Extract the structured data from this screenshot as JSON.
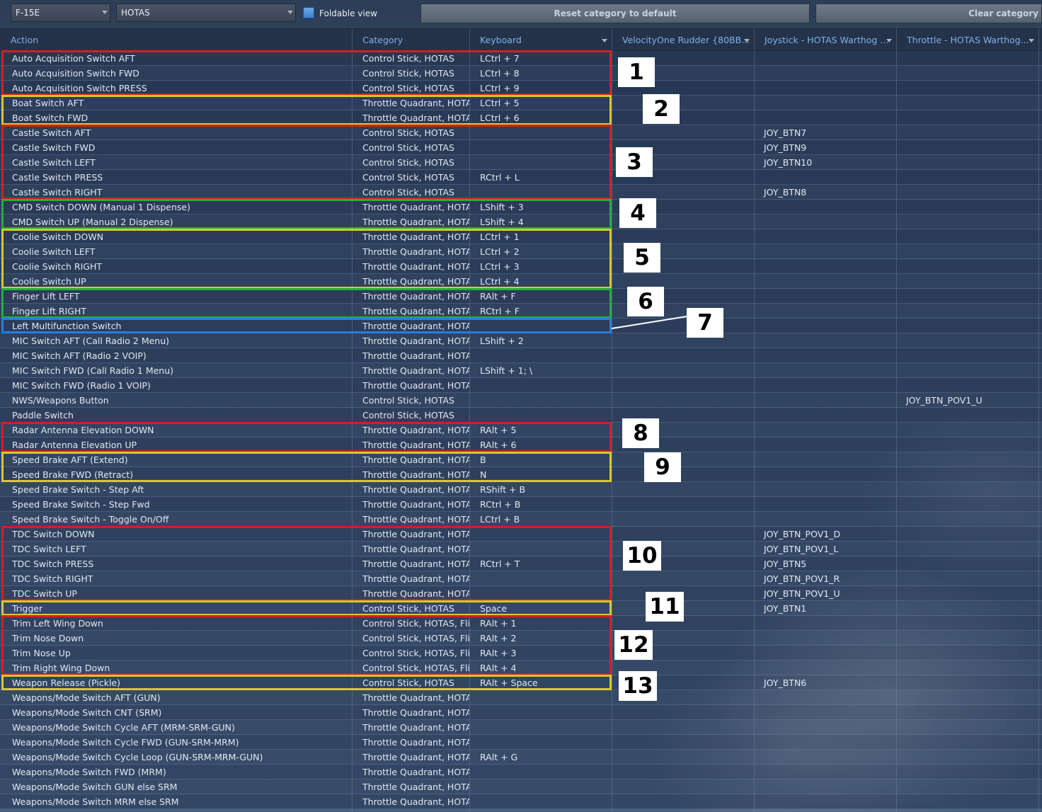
{
  "toolbar": {
    "aircraft": "F-15E",
    "category": "HOTAS",
    "foldable_label": "Foldable view",
    "reset_label": "Reset category to default",
    "clear_label": "Clear category"
  },
  "columns": {
    "action": "Action",
    "category": "Category",
    "keyboard": "Keyboard",
    "rudder": "VelocityOne Rudder {80BB...",
    "joystick": "Joystick - HOTAS Warthog ...",
    "throttle": "Throttle - HOTAS Warthog..."
  },
  "rows": [
    {
      "action": "Auto Acquisition Switch AFT",
      "category": "Control Stick, HOTAS",
      "keyboard": "LCtrl + 7",
      "rudder": "",
      "joystick": "",
      "throttle": ""
    },
    {
      "action": "Auto Acquisition Switch FWD",
      "category": "Control Stick, HOTAS",
      "keyboard": "LCtrl + 8",
      "rudder": "",
      "joystick": "",
      "throttle": ""
    },
    {
      "action": "Auto Acquisition Switch PRESS",
      "category": "Control Stick, HOTAS",
      "keyboard": "LCtrl + 9",
      "rudder": "",
      "joystick": "",
      "throttle": ""
    },
    {
      "action": "Boat Switch AFT",
      "category": "Throttle Quadrant, HOTAS",
      "keyboard": "LCtrl + 5",
      "rudder": "",
      "joystick": "",
      "throttle": ""
    },
    {
      "action": "Boat Switch FWD",
      "category": "Throttle Quadrant, HOTAS",
      "keyboard": "LCtrl + 6",
      "rudder": "",
      "joystick": "",
      "throttle": ""
    },
    {
      "action": "Castle Switch AFT",
      "category": "Control Stick, HOTAS",
      "keyboard": "",
      "rudder": "",
      "joystick": "JOY_BTN7",
      "throttle": ""
    },
    {
      "action": "Castle Switch FWD",
      "category": "Control Stick, HOTAS",
      "keyboard": "",
      "rudder": "",
      "joystick": "JOY_BTN9",
      "throttle": ""
    },
    {
      "action": "Castle Switch LEFT",
      "category": "Control Stick, HOTAS",
      "keyboard": "",
      "rudder": "",
      "joystick": "JOY_BTN10",
      "throttle": ""
    },
    {
      "action": "Castle Switch PRESS",
      "category": "Control Stick, HOTAS",
      "keyboard": "RCtrl + L",
      "rudder": "",
      "joystick": "",
      "throttle": ""
    },
    {
      "action": "Castle Switch RIGHT",
      "category": "Control Stick, HOTAS",
      "keyboard": "",
      "rudder": "",
      "joystick": "JOY_BTN8",
      "throttle": ""
    },
    {
      "action": "CMD Switch DOWN (Manual 1 Dispense)",
      "category": "Throttle Quadrant, HOTAS",
      "keyboard": "LShift + 3",
      "rudder": "",
      "joystick": "",
      "throttle": ""
    },
    {
      "action": "CMD Switch UP (Manual 2 Dispense)",
      "category": "Throttle Quadrant, HOTAS",
      "keyboard": "LShift + 4",
      "rudder": "",
      "joystick": "",
      "throttle": ""
    },
    {
      "action": "Coolie Switch DOWN",
      "category": "Throttle Quadrant, HOTAS",
      "keyboard": "LCtrl + 1",
      "rudder": "",
      "joystick": "",
      "throttle": ""
    },
    {
      "action": "Coolie Switch LEFT",
      "category": "Throttle Quadrant, HOTAS",
      "keyboard": "LCtrl + 2",
      "rudder": "",
      "joystick": "",
      "throttle": ""
    },
    {
      "action": "Coolie Switch RIGHT",
      "category": "Throttle Quadrant, HOTAS",
      "keyboard": "LCtrl + 3",
      "rudder": "",
      "joystick": "",
      "throttle": ""
    },
    {
      "action": "Coolie Switch UP",
      "category": "Throttle Quadrant, HOTAS",
      "keyboard": "LCtrl + 4",
      "rudder": "",
      "joystick": "",
      "throttle": ""
    },
    {
      "action": "Finger Lift LEFT",
      "category": "Throttle Quadrant, HOTAS",
      "keyboard": "RAlt + F",
      "rudder": "",
      "joystick": "",
      "throttle": ""
    },
    {
      "action": "Finger Lift RIGHT",
      "category": "Throttle Quadrant, HOTAS",
      "keyboard": "RCtrl + F",
      "rudder": "",
      "joystick": "",
      "throttle": ""
    },
    {
      "action": "Left Multifunction Switch",
      "category": "Throttle Quadrant, HOTAS",
      "keyboard": "",
      "rudder": "",
      "joystick": "",
      "throttle": ""
    },
    {
      "action": "MIC Switch AFT (Call Radio 2 Menu)",
      "category": "Throttle Quadrant, HOTAS",
      "keyboard": "LShift + 2",
      "rudder": "",
      "joystick": "",
      "throttle": ""
    },
    {
      "action": "MIC Switch AFT (Radio 2 VOIP)",
      "category": "Throttle Quadrant, HOTAS",
      "keyboard": "",
      "rudder": "",
      "joystick": "",
      "throttle": ""
    },
    {
      "action": "MIC Switch FWD (Call Radio 1 Menu)",
      "category": "Throttle Quadrant, HOTAS",
      "keyboard": "LShift + 1; \\",
      "rudder": "",
      "joystick": "",
      "throttle": ""
    },
    {
      "action": "MIC Switch FWD (Radio 1 VOIP)",
      "category": "Throttle Quadrant, HOTAS",
      "keyboard": "",
      "rudder": "",
      "joystick": "",
      "throttle": ""
    },
    {
      "action": "NWS/Weapons Button",
      "category": "Control Stick, HOTAS",
      "keyboard": "",
      "rudder": "",
      "joystick": "",
      "throttle": "JOY_BTN_POV1_U"
    },
    {
      "action": "Paddle Switch",
      "category": "Control Stick, HOTAS",
      "keyboard": "",
      "rudder": "",
      "joystick": "",
      "throttle": ""
    },
    {
      "action": "Radar Antenna Elevation DOWN",
      "category": "Throttle Quadrant, HOTAS",
      "keyboard": "RAlt + 5",
      "rudder": "",
      "joystick": "",
      "throttle": ""
    },
    {
      "action": "Radar Antenna Elevation UP",
      "category": "Throttle Quadrant, HOTAS",
      "keyboard": "RAlt + 6",
      "rudder": "",
      "joystick": "",
      "throttle": ""
    },
    {
      "action": "Speed Brake AFT (Extend)",
      "category": "Throttle Quadrant, HOTAS",
      "keyboard": "B",
      "rudder": "",
      "joystick": "",
      "throttle": ""
    },
    {
      "action": "Speed Brake FWD (Retract)",
      "category": "Throttle Quadrant, HOTAS",
      "keyboard": "N",
      "rudder": "",
      "joystick": "",
      "throttle": ""
    },
    {
      "action": "Speed Brake Switch - Step Aft",
      "category": "Throttle Quadrant, HOTAS",
      "keyboard": "RShift + B",
      "rudder": "",
      "joystick": "",
      "throttle": ""
    },
    {
      "action": "Speed Brake Switch - Step Fwd",
      "category": "Throttle Quadrant, HOTAS",
      "keyboard": "RCtrl + B",
      "rudder": "",
      "joystick": "",
      "throttle": ""
    },
    {
      "action": "Speed Brake Switch - Toggle On/Off",
      "category": "Throttle Quadrant, HOTAS",
      "keyboard": "LCtrl + B",
      "rudder": "",
      "joystick": "",
      "throttle": ""
    },
    {
      "action": "TDC Switch DOWN",
      "category": "Throttle Quadrant, HOTAS",
      "keyboard": "",
      "rudder": "",
      "joystick": "JOY_BTN_POV1_D",
      "throttle": ""
    },
    {
      "action": "TDC Switch LEFT",
      "category": "Throttle Quadrant, HOTAS",
      "keyboard": "",
      "rudder": "",
      "joystick": "JOY_BTN_POV1_L",
      "throttle": ""
    },
    {
      "action": "TDC Switch PRESS",
      "category": "Throttle Quadrant, HOTAS",
      "keyboard": "RCtrl + T",
      "rudder": "",
      "joystick": "JOY_BTN5",
      "throttle": ""
    },
    {
      "action": "TDC Switch RIGHT",
      "category": "Throttle Quadrant, HOTAS",
      "keyboard": "",
      "rudder": "",
      "joystick": "JOY_BTN_POV1_R",
      "throttle": ""
    },
    {
      "action": "TDC Switch UP",
      "category": "Throttle Quadrant, HOTAS",
      "keyboard": "",
      "rudder": "",
      "joystick": "JOY_BTN_POV1_U",
      "throttle": ""
    },
    {
      "action": "Trigger",
      "category": "Control Stick, HOTAS",
      "keyboard": "Space",
      "rudder": "",
      "joystick": "JOY_BTN1",
      "throttle": ""
    },
    {
      "action": "Trim Left Wing Down",
      "category": "Control Stick, HOTAS, Flig",
      "keyboard": "RAlt + 1",
      "rudder": "",
      "joystick": "",
      "throttle": ""
    },
    {
      "action": "Trim Nose Down",
      "category": "Control Stick, HOTAS, Flig",
      "keyboard": "RAlt + 2",
      "rudder": "",
      "joystick": "",
      "throttle": ""
    },
    {
      "action": "Trim Nose Up",
      "category": "Control Stick, HOTAS, Flig",
      "keyboard": "RAlt + 3",
      "rudder": "",
      "joystick": "",
      "throttle": ""
    },
    {
      "action": "Trim Right Wing Down",
      "category": "Control Stick, HOTAS, Flig",
      "keyboard": "RAlt + 4",
      "rudder": "",
      "joystick": "",
      "throttle": ""
    },
    {
      "action": "Weapon Release (Pickle)",
      "category": "Control Stick, HOTAS",
      "keyboard": "RAlt + Space",
      "rudder": "",
      "joystick": "JOY_BTN6",
      "throttle": ""
    },
    {
      "action": "Weapons/Mode Switch AFT (GUN)",
      "category": "Throttle Quadrant, HOTAS",
      "keyboard": "",
      "rudder": "",
      "joystick": "",
      "throttle": ""
    },
    {
      "action": "Weapons/Mode Switch CNT (SRM)",
      "category": "Throttle Quadrant, HOTAS",
      "keyboard": "",
      "rudder": "",
      "joystick": "",
      "throttle": ""
    },
    {
      "action": "Weapons/Mode Switch Cycle AFT (MRM-SRM-GUN)",
      "category": "Throttle Quadrant, HOTAS",
      "keyboard": "",
      "rudder": "",
      "joystick": "",
      "throttle": ""
    },
    {
      "action": "Weapons/Mode Switch Cycle FWD (GUN-SRM-MRM)",
      "category": "Throttle Quadrant, HOTAS",
      "keyboard": "",
      "rudder": "",
      "joystick": "",
      "throttle": ""
    },
    {
      "action": "Weapons/Mode Switch Cycle Loop (GUN-SRM-MRM-GUN)",
      "category": "Throttle Quadrant, HOTAS",
      "keyboard": "RAlt + G",
      "rudder": "",
      "joystick": "",
      "throttle": ""
    },
    {
      "action": "Weapons/Mode Switch FWD (MRM)",
      "category": "Throttle Quadrant, HOTAS",
      "keyboard": "",
      "rudder": "",
      "joystick": "",
      "throttle": ""
    },
    {
      "action": "Weapons/Mode Switch GUN else SRM",
      "category": "Throttle Quadrant, HOTAS",
      "keyboard": "",
      "rudder": "",
      "joystick": "",
      "throttle": ""
    },
    {
      "action": "Weapons/Mode Switch MRM else SRM",
      "category": "Throttle Quadrant, HOTAS",
      "keyboard": "",
      "rudder": "",
      "joystick": "",
      "throttle": ""
    }
  ],
  "annotations": [
    {
      "label": "1",
      "color": "#d41f1f",
      "first_row": 0,
      "last_row": 2
    },
    {
      "label": "2",
      "color": "#d9c82a",
      "first_row": 3,
      "last_row": 4
    },
    {
      "label": "3",
      "color": "#d41f1f",
      "first_row": 5,
      "last_row": 9
    },
    {
      "label": "4",
      "color": "#1fb23a",
      "first_row": 10,
      "last_row": 11
    },
    {
      "label": "5",
      "color": "#d9c82a",
      "first_row": 12,
      "last_row": 15
    },
    {
      "label": "6",
      "color": "#1fb23a",
      "first_row": 16,
      "last_row": 17
    },
    {
      "label": "7",
      "color": "#2a7de0",
      "first_row": 18,
      "last_row": 18
    },
    {
      "label": "8",
      "color": "#d41f1f",
      "first_row": 25,
      "last_row": 26
    },
    {
      "label": "9",
      "color": "#d9c82a",
      "first_row": 27,
      "last_row": 28
    },
    {
      "label": "10",
      "color": "#d41f1f",
      "first_row": 32,
      "last_row": 36
    },
    {
      "label": "11",
      "color": "#d9c82a",
      "first_row": 37,
      "last_row": 37
    },
    {
      "label": "12",
      "color": "#d41f1f",
      "first_row": 38,
      "last_row": 41
    },
    {
      "label": "13",
      "color": "#d9c82a",
      "first_row": 42,
      "last_row": 42
    }
  ]
}
